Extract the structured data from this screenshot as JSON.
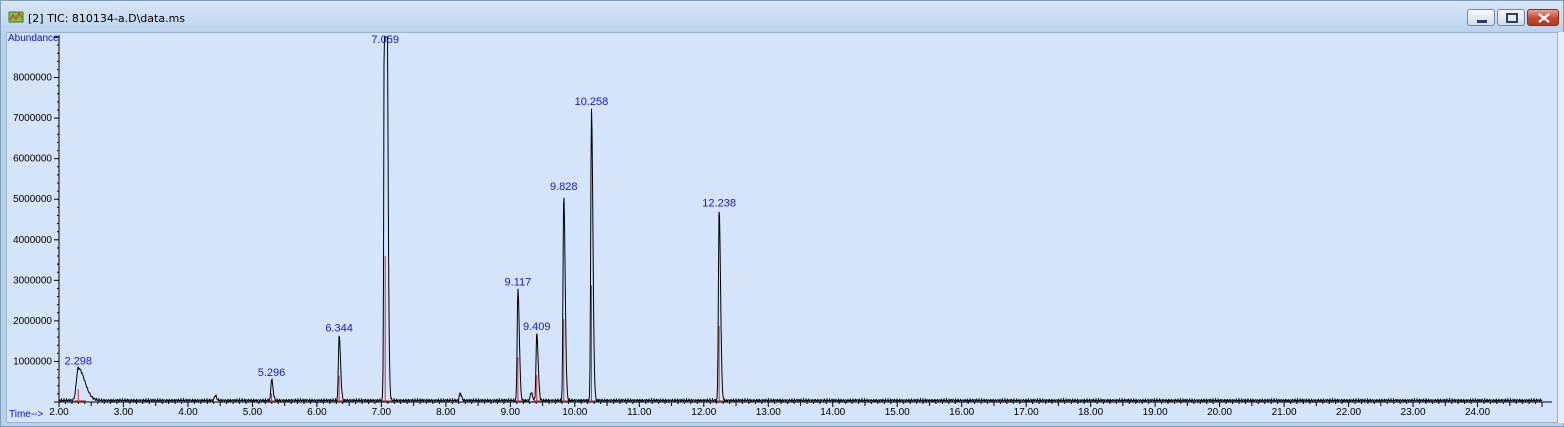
{
  "window": {
    "title": "[2] TIC: 810134-a.D\\data.ms",
    "icon": "chromatogram-app-icon",
    "controls": [
      "minimize-icon",
      "maximize-icon",
      "close-icon"
    ]
  },
  "colors": {
    "trace": "#000000",
    "baseline": "#d03030",
    "peak_label": "#1818d0",
    "axis_title": "#1010c8",
    "plot_background": "#d3e4fb"
  },
  "chart_data": {
    "type": "line",
    "title": "",
    "xlabel": "Time-->",
    "ylabel": "Abundance",
    "xlim": [
      2.0,
      25.0
    ],
    "ylim": [
      0,
      9000000
    ],
    "grid": false,
    "legend": "none",
    "x_ticks": [
      "2.00",
      "3.00",
      "4.00",
      "5.00",
      "6.00",
      "7.00",
      "8.00",
      "9.00",
      "10.00",
      "11.00",
      "12.00",
      "13.00",
      "14.00",
      "15.00",
      "16.00",
      "17.00",
      "18.00",
      "19.00",
      "20.00",
      "21.00",
      "22.00",
      "23.00",
      "24.00"
    ],
    "y_ticks": [
      "1000000",
      "2000000",
      "3000000",
      "4000000",
      "5000000",
      "6000000",
      "7000000",
      "8000000"
    ],
    "peaks": [
      {
        "label": "2.298",
        "x": 2.298,
        "y": 800000
      },
      {
        "label": "5.296",
        "x": 5.296,
        "y": 520000
      },
      {
        "label": "6.344",
        "x": 6.344,
        "y": 1620000
      },
      {
        "label": "7.059",
        "x": 7.059,
        "y": 9000000
      },
      {
        "label": "9.117",
        "x": 9.117,
        "y": 2750000
      },
      {
        "label": "9.409",
        "x": 9.409,
        "y": 1650000
      },
      {
        "label": "9.828",
        "x": 9.828,
        "y": 5100000
      },
      {
        "label": "10.258",
        "x": 10.258,
        "y": 7200000
      },
      {
        "label": "12.238",
        "x": 12.238,
        "y": 4700000
      }
    ],
    "minor_peaks": [
      {
        "x": 4.42,
        "y": 120000
      },
      {
        "x": 7.05,
        "y": 8900000
      },
      {
        "x": 7.08,
        "y": 8100000
      },
      {
        "x": 8.22,
        "y": 180000
      },
      {
        "x": 9.32,
        "y": 200000
      }
    ]
  }
}
